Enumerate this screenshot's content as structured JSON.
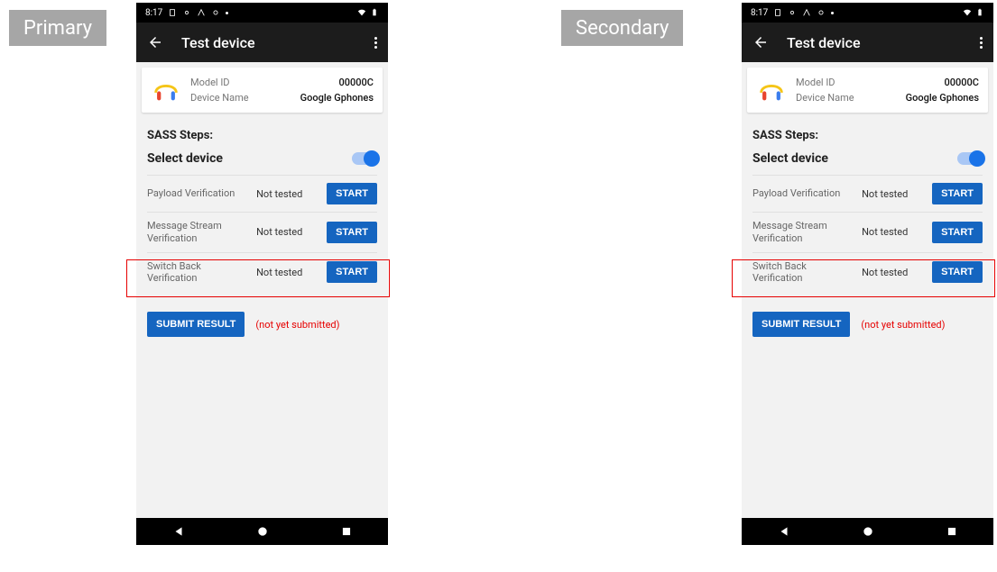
{
  "labels": {
    "primary": "Primary",
    "secondary": "Secondary"
  },
  "status": {
    "time": "8:17"
  },
  "appbar": {
    "title": "Test device"
  },
  "card": {
    "model_id_label": "Model ID",
    "model_id_value": "00000C",
    "device_name_label": "Device Name",
    "device_name_value": "Google Gphones"
  },
  "sass": {
    "steps_title": "SASS Steps:",
    "select_device": "Select device",
    "start": "START",
    "tests": [
      {
        "name": "Payload Verification",
        "status": "Not tested"
      },
      {
        "name": "Message Stream Verification",
        "status": "Not tested"
      },
      {
        "name": "Switch Back Verification",
        "status": "Not tested"
      }
    ],
    "submit": "SUBMIT RESULT",
    "not_submitted": "(not yet submitted)"
  }
}
